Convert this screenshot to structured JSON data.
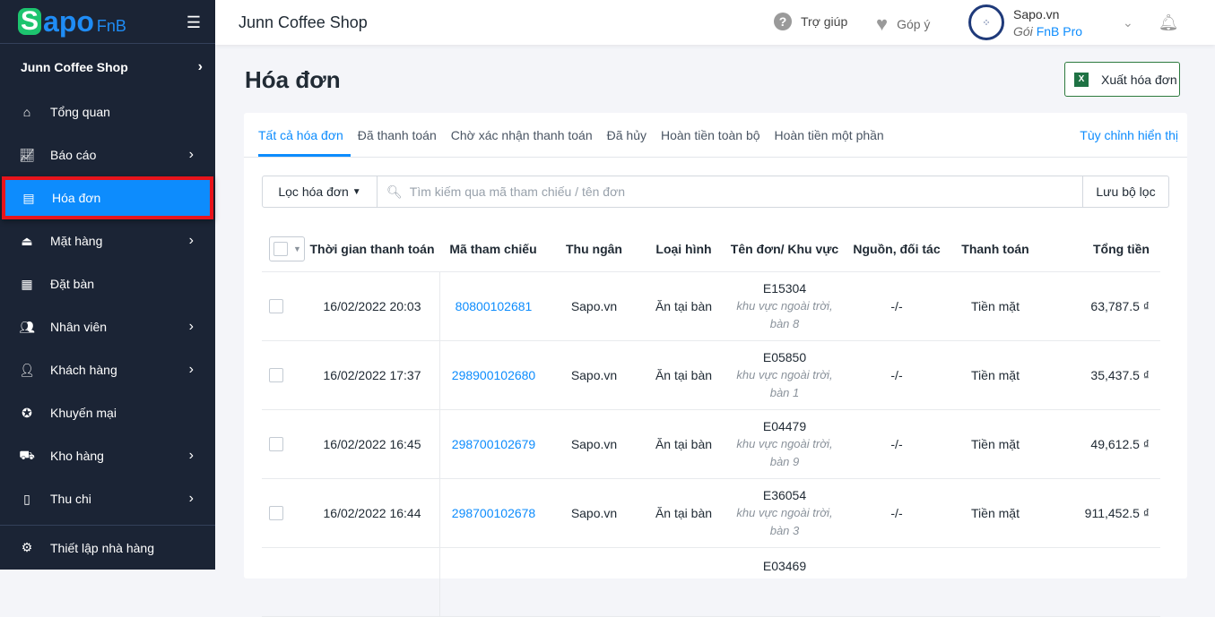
{
  "brand": {
    "s": "S",
    "apo": "apo",
    "fnb": "FnB"
  },
  "sidebar": {
    "shop": "Junn Coffee Shop",
    "items": [
      {
        "label": "Tổng quan",
        "icon": "home-icon",
        "chevron": false
      },
      {
        "label": "Báo cáo",
        "icon": "chart-icon",
        "chevron": true
      },
      {
        "label": "Hóa đơn",
        "icon": "invoice-icon",
        "chevron": false,
        "active": true
      },
      {
        "label": "Mặt hàng",
        "icon": "dish-icon",
        "chevron": true
      },
      {
        "label": "Đặt bàn",
        "icon": "calendar-icon",
        "chevron": false
      },
      {
        "label": "Nhân viên",
        "icon": "staff-icon",
        "chevron": true
      },
      {
        "label": "Khách hàng",
        "icon": "user-icon",
        "chevron": true
      },
      {
        "label": "Khuyến mại",
        "icon": "promo-icon",
        "chevron": false
      },
      {
        "label": "Kho hàng",
        "icon": "warehouse-icon",
        "chevron": true
      },
      {
        "label": "Thu chi",
        "icon": "cashbook-icon",
        "chevron": true
      }
    ],
    "settings": "Thiết lập nhà hàng"
  },
  "topbar": {
    "title": "Junn Coffee Shop",
    "help": "Trợ giúp",
    "feedback": "Góp ý",
    "account": "Sapo.vn",
    "plan_prefix": "Gói",
    "plan": "FnB Pro"
  },
  "page": {
    "title": "Hóa đơn",
    "export": "Xuất hóa đơn"
  },
  "tabs": [
    "Tất cả hóa đơn",
    "Đã thanh toán",
    "Chờ xác nhận thanh toán",
    "Đã hủy",
    "Hoàn tiền toàn bộ",
    "Hoàn tiền một phần"
  ],
  "customize": "Tùy chỉnh hiển thị",
  "filter": {
    "button": "Lọc hóa đơn",
    "placeholder": "Tìm kiếm qua mã tham chiếu / tên đơn",
    "save": "Lưu bộ lọc"
  },
  "table": {
    "headers": [
      "Thời gian thanh toán",
      "Mã tham chiếu",
      "Thu ngân",
      "Loại hình",
      "Tên đơn/ Khu vực",
      "Nguồn, đối tác",
      "Thanh toán",
      "Tổng tiền"
    ],
    "rows": [
      {
        "time": "16/02/2022 20:03",
        "ref": "80800102681",
        "cashier": "Sapo.vn",
        "type": "Ăn tại bàn",
        "name": "E15304",
        "area": "khu vực ngoài trời,",
        "table": "bàn 8",
        "source": "-/-",
        "payment": "Tiền mặt",
        "total": "63,787.5 ₫"
      },
      {
        "time": "16/02/2022 17:37",
        "ref": "298900102680",
        "cashier": "Sapo.vn",
        "type": "Ăn tại bàn",
        "name": "E05850",
        "area": "khu vực ngoài trời,",
        "table": "bàn 1",
        "source": "-/-",
        "payment": "Tiền mặt",
        "total": "35,437.5 ₫"
      },
      {
        "time": "16/02/2022 16:45",
        "ref": "298700102679",
        "cashier": "Sapo.vn",
        "type": "Ăn tại bàn",
        "name": "E04479",
        "area": "khu vực ngoài trời,",
        "table": "bàn 9",
        "source": "-/-",
        "payment": "Tiền mặt",
        "total": "49,612.5 ₫"
      },
      {
        "time": "16/02/2022 16:44",
        "ref": "298700102678",
        "cashier": "Sapo.vn",
        "type": "Ăn tại bàn",
        "name": "E36054",
        "area": "khu vực ngoài trời,",
        "table": "bàn 3",
        "source": "-/-",
        "payment": "Tiền mặt",
        "total": "911,452.5 ₫"
      },
      {
        "name": "E03469"
      }
    ]
  }
}
